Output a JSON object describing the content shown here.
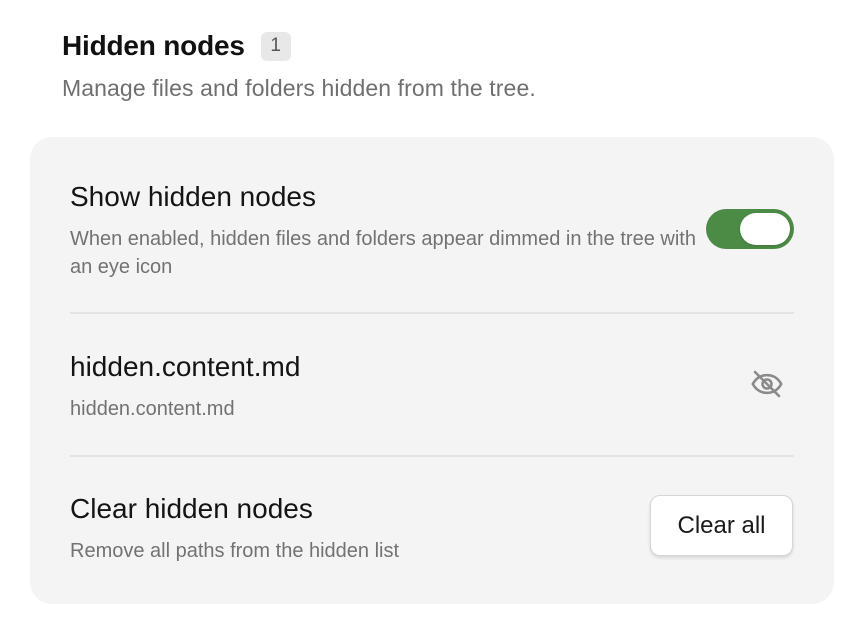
{
  "section": {
    "title": "Hidden nodes",
    "count": "1",
    "subtitle": "Manage files and folders hidden from the tree."
  },
  "show_hidden": {
    "title": "Show hidden nodes",
    "description": "When enabled, hidden files and folders appear dimmed in the tree with an eye icon",
    "enabled": true,
    "toggle_color": "#4b8b45"
  },
  "hidden_items": [
    {
      "name": "hidden.content.md",
      "path": "hidden.content.md",
      "icon": "eye-off-icon"
    }
  ],
  "clear": {
    "title": "Clear hidden nodes",
    "description": "Remove all paths from the hidden list",
    "button_label": "Clear all"
  }
}
